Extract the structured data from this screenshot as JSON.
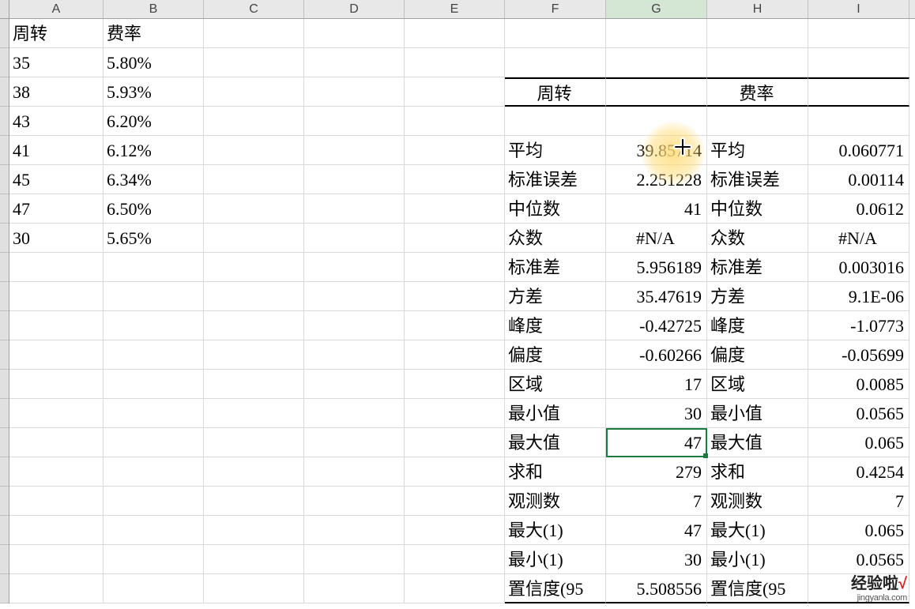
{
  "columns": [
    "A",
    "B",
    "C",
    "D",
    "E",
    "F",
    "G",
    "H",
    "I"
  ],
  "activeColumn": "G",
  "leftTable": {
    "headers": {
      "A": "周转",
      "B": "费率"
    },
    "rows": [
      {
        "A": "35",
        "B": "5.80%"
      },
      {
        "A": "38",
        "B": "5.93%"
      },
      {
        "A": "43",
        "B": "6.20%"
      },
      {
        "A": "41",
        "B": "6.12%"
      },
      {
        "A": "45",
        "B": "6.34%"
      },
      {
        "A": "47",
        "B": "6.50%"
      },
      {
        "A": "30",
        "B": "5.65%"
      }
    ]
  },
  "statsTable": {
    "header1": "周转",
    "header2": "费率",
    "rows": [
      {
        "label1": "平均",
        "val1": "39.85714",
        "label2": "平均",
        "val2": "0.060771"
      },
      {
        "label1": "标准误差",
        "val1": "2.251228",
        "label2": "标准误差",
        "val2": "0.00114"
      },
      {
        "label1": "中位数",
        "val1": "41",
        "label2": "中位数",
        "val2": "0.0612"
      },
      {
        "label1": "众数",
        "val1": "#N/A",
        "label2": "众数",
        "val2": "#N/A"
      },
      {
        "label1": "标准差",
        "val1": "5.956189",
        "label2": "标准差",
        "val2": "0.003016"
      },
      {
        "label1": "方差",
        "val1": "35.47619",
        "label2": "方差",
        "val2": "9.1E-06"
      },
      {
        "label1": "峰度",
        "val1": "-0.42725",
        "label2": "峰度",
        "val2": "-1.0773"
      },
      {
        "label1": "偏度",
        "val1": "-0.60266",
        "label2": "偏度",
        "val2": "-0.05699"
      },
      {
        "label1": "区域",
        "val1": "17",
        "label2": "区域",
        "val2": "0.0085"
      },
      {
        "label1": "最小值",
        "val1": "30",
        "label2": "最小值",
        "val2": "0.0565"
      },
      {
        "label1": "最大值",
        "val1": "47",
        "label2": "最大值",
        "val2": "0.065"
      },
      {
        "label1": "求和",
        "val1": "279",
        "label2": "求和",
        "val2": "0.4254"
      },
      {
        "label1": "观测数",
        "val1": "7",
        "label2": "观测数",
        "val2": "7"
      },
      {
        "label1": "最大(1)",
        "val1": "47",
        "label2": "最大(1)",
        "val2": "0.065"
      },
      {
        "label1": "最小(1)",
        "val1": "30",
        "label2": "最小(1)",
        "val2": "0.0565"
      },
      {
        "label1": "置信度(95",
        "val1": "5.508556",
        "label2": "置信度(95",
        "val2": ""
      }
    ]
  },
  "selectedCell": "G15",
  "watermark": {
    "line1_a": "经验啦",
    "line1_b": "√",
    "line2": "jingyanla.com"
  }
}
